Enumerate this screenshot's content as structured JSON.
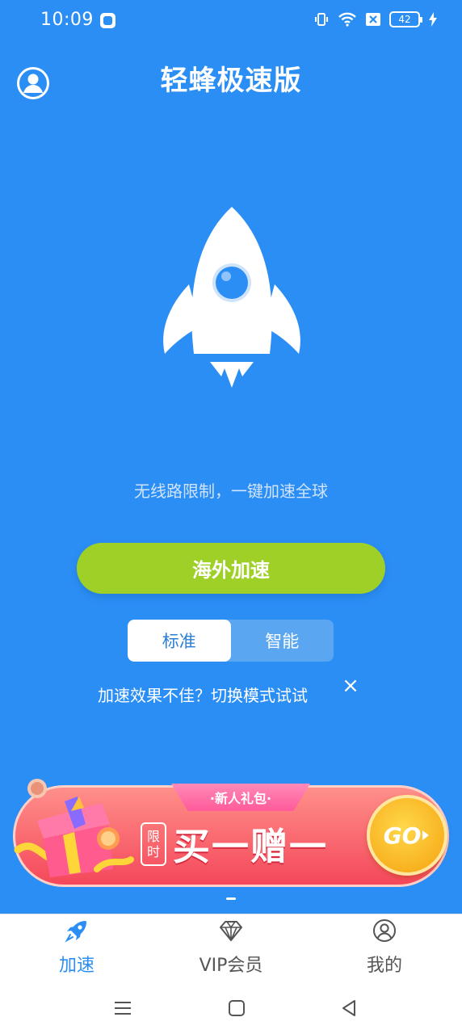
{
  "status_bar": {
    "time": "10:09",
    "battery": "42"
  },
  "header": {
    "title": "轻蜂极速版"
  },
  "hero": {
    "slogan": "无线路限制，一键加速全球"
  },
  "main_button": {
    "label": "海外加速"
  },
  "mode_toggle": {
    "options": [
      "标准",
      "智能"
    ],
    "selected": "标准"
  },
  "hint": {
    "text": "加速效果不佳？切换模式试试",
    "close_symbol": "×"
  },
  "banner": {
    "ribbon": "·新人礼包·",
    "limit_tag_top": "限",
    "limit_tag_bottom": "时",
    "promo": "买一赠一",
    "go": "GO"
  },
  "tabbar": {
    "tabs": [
      {
        "label": "加速",
        "icon": "rocket-icon",
        "active": true
      },
      {
        "label": "VIP会员",
        "icon": "diamond-icon",
        "active": false
      },
      {
        "label": "我的",
        "icon": "user-icon",
        "active": false
      }
    ]
  },
  "colors": {
    "background": "#2b8ef5",
    "primary_button": "#9fd027",
    "active_tab": "#2b8ef5"
  }
}
